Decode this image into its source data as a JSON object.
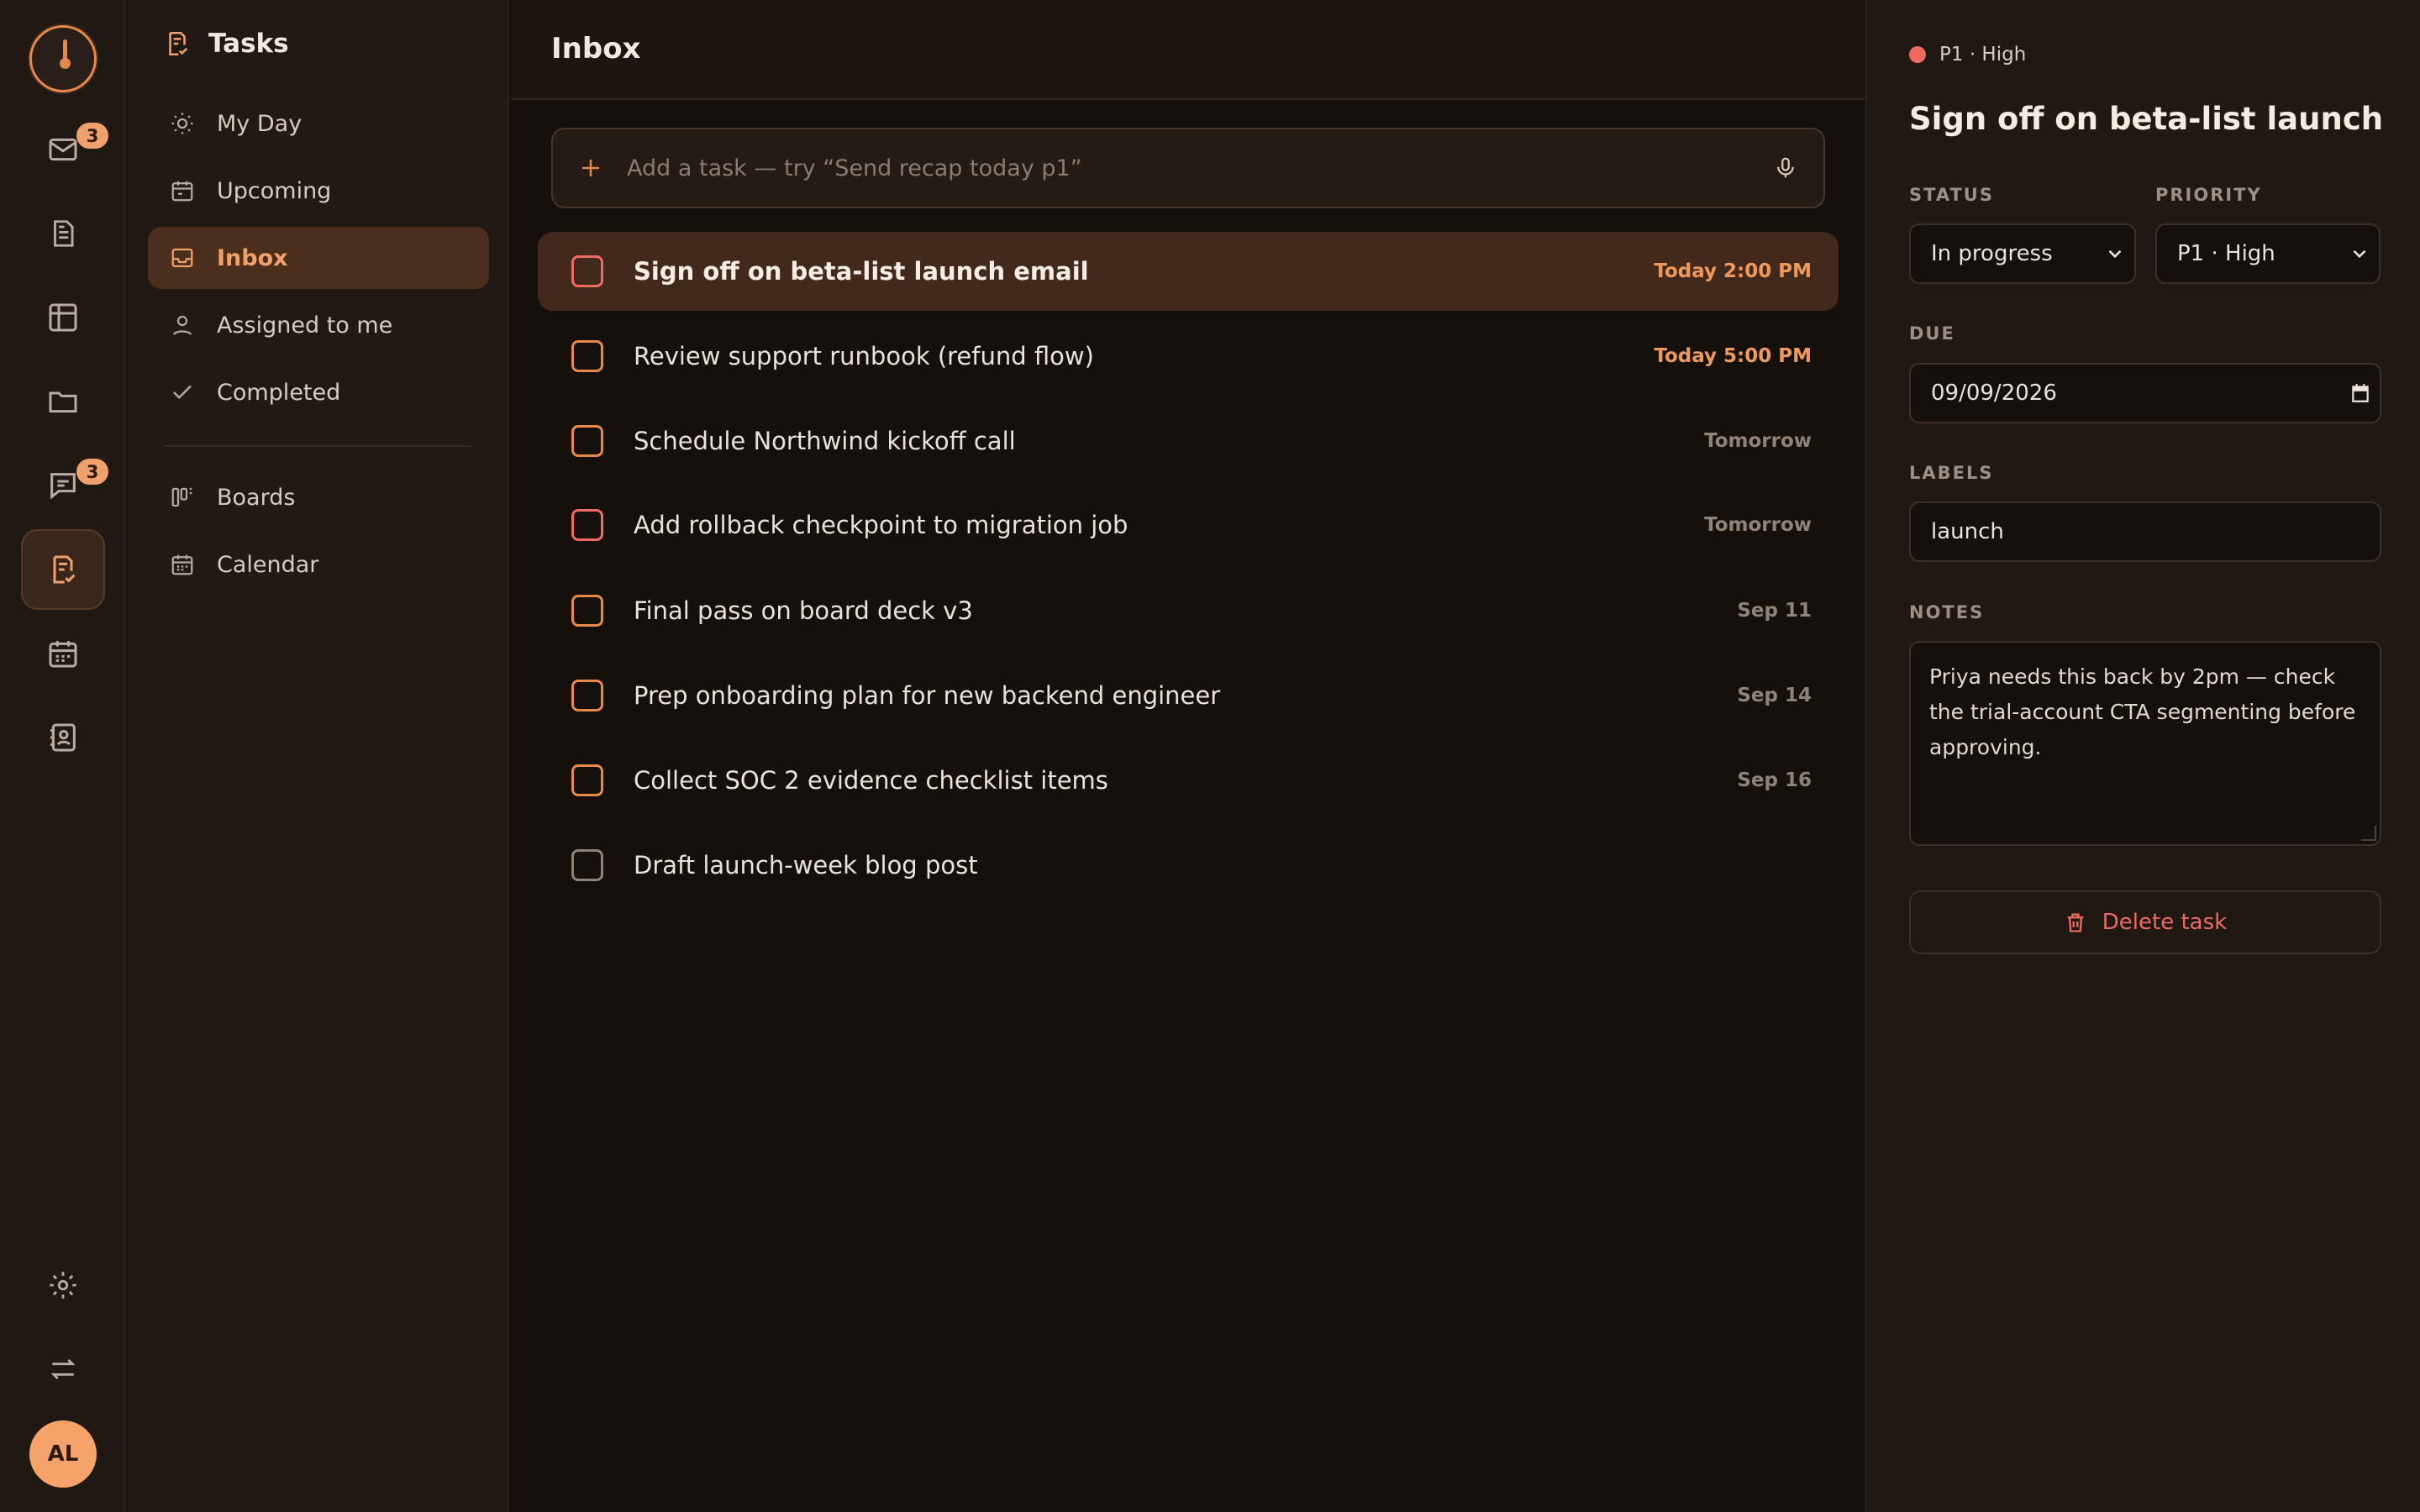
{
  "rail": {
    "items": [
      {
        "name": "mail",
        "badge": "3"
      },
      {
        "name": "docs"
      },
      {
        "name": "tables"
      },
      {
        "name": "files"
      },
      {
        "name": "chat",
        "badge": "3"
      },
      {
        "name": "tasks",
        "active": true
      },
      {
        "name": "calendar"
      },
      {
        "name": "contacts"
      }
    ],
    "avatar_initials": "AL"
  },
  "sidebar": {
    "title": "Tasks",
    "items": [
      {
        "label": "My Day",
        "icon": "sun-icon"
      },
      {
        "label": "Upcoming",
        "icon": "calendar-icon"
      },
      {
        "label": "Inbox",
        "icon": "inbox-icon",
        "active": true
      },
      {
        "label": "Assigned to me",
        "icon": "person-icon"
      },
      {
        "label": "Completed",
        "icon": "check-icon"
      }
    ],
    "secondary": [
      {
        "label": "Boards",
        "icon": "board-icon"
      },
      {
        "label": "Calendar",
        "icon": "calendar-icon"
      }
    ]
  },
  "main": {
    "title": "Inbox",
    "add_placeholder": "Add a task — try “Send recap today p1”",
    "tasks": [
      {
        "title": "Sign off on beta-list launch email",
        "due": "Today 2:00 PM",
        "priority": "red",
        "selected": true
      },
      {
        "title": "Review support runbook (refund flow)",
        "due": "Today 5:00 PM",
        "priority": "orange"
      },
      {
        "title": "Schedule Northwind kickoff call",
        "due": "Tomorrow",
        "priority": "orange"
      },
      {
        "title": "Add rollback checkpoint to migration job",
        "due": "Tomorrow",
        "priority": "red"
      },
      {
        "title": "Final pass on board deck v3",
        "due": "Sep 11",
        "priority": "orange"
      },
      {
        "title": "Prep onboarding plan for new backend engineer",
        "due": "Sep 14",
        "priority": "orange"
      },
      {
        "title": "Collect SOC 2 evidence checklist items",
        "due": "Sep 16",
        "priority": "orange"
      },
      {
        "title": "Draft launch-week blog post",
        "due": "",
        "priority": "gray"
      }
    ]
  },
  "detail": {
    "priority_chip": "P1 · High",
    "title": "Sign off on beta-list launch email",
    "status_label": "STATUS",
    "status_value": "In progress",
    "priority_label": "PRIORITY",
    "priority_value": "P1 · High",
    "due_label": "DUE",
    "due_value": "09/09/2026",
    "labels_label": "LABELS",
    "labels_value": "launch",
    "notes_label": "NOTES",
    "notes_value": "Priya needs this back by 2pm — check the trial-account CTA segmenting before approving.",
    "delete_label": "Delete task"
  },
  "colors": {
    "accent": "#e8894a",
    "priority_high": "#ef6a60",
    "background": "#15100c"
  }
}
